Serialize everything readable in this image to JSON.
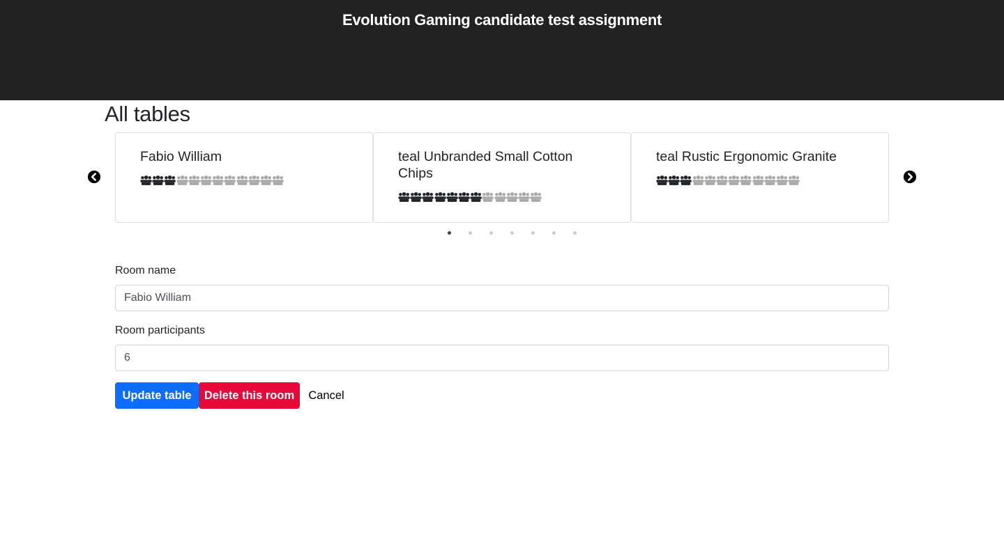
{
  "header": {
    "title": "Evolution Gaming candidate test assignment"
  },
  "section": {
    "title": "All tables"
  },
  "carousel": {
    "prev_icon": "chevron-left-circle-icon",
    "next_icon": "chevron-right-circle-icon",
    "occupied_color": "#212529",
    "empty_color": "#aaaaaa",
    "cards": [
      {
        "title": "Fabio William",
        "participants": 3,
        "capacity": 12
      },
      {
        "title": "teal Unbranded Small Cotton Chips",
        "participants": 7,
        "capacity": 12
      },
      {
        "title": "teal Rustic Ergonomic Granite",
        "participants": 3,
        "capacity": 12
      }
    ],
    "pages": 7,
    "active_page": 1
  },
  "form": {
    "name_label": "Room name",
    "name_value": "Fabio William",
    "participants_label": "Room participants",
    "participants_value": "6",
    "update_label": "Update table",
    "delete_label": "Delete this room",
    "cancel_label": "Cancel",
    "update_color": "#0d6efd",
    "delete_color": "#e8093a"
  }
}
